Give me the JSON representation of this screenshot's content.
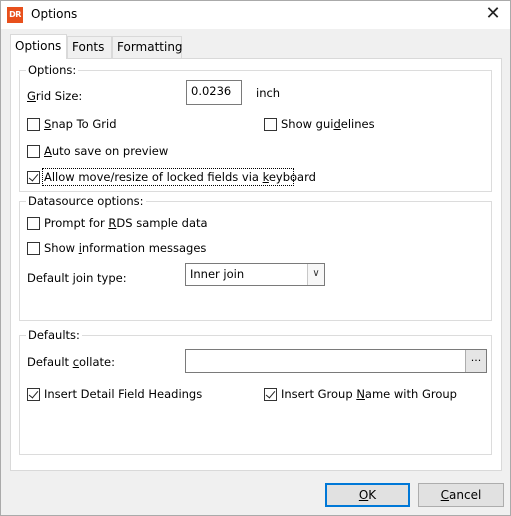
{
  "window": {
    "title": "Options",
    "app_icon_text": "DR",
    "close_glyph": "✕"
  },
  "tabs": [
    {
      "label": "Options",
      "active": true
    },
    {
      "label": "Fonts",
      "active": false
    },
    {
      "label": "Formatting",
      "active": false
    }
  ],
  "options_group": {
    "label": "Options:",
    "grid_size_label_pre": "",
    "grid_size_mnemonic": "G",
    "grid_size_label_post": "rid Size:",
    "grid_size_value": "0.0236",
    "grid_size_unit": "inch",
    "snap_to_grid": {
      "mnemonic": "S",
      "rest": "nap To Grid",
      "checked": false
    },
    "show_guidelines": {
      "pre": "Show gui",
      "mnemonic": "d",
      "post": "elines",
      "checked": false
    },
    "auto_save": {
      "pre": "",
      "mnemonic": "A",
      "post": "uto save on preview",
      "checked": false
    },
    "allow_move": {
      "pre": "Allow move/resize of locked fields via ",
      "mnemonic": "k",
      "post": "eyboard",
      "checked": true
    }
  },
  "datasource_group": {
    "label": "Datasource options:",
    "prompt_rds": {
      "pre": "Prompt for ",
      "mnemonic": "R",
      "post": "DS sample data",
      "checked": false
    },
    "show_info": {
      "pre": "Show ",
      "mnemonic": "i",
      "post": "nformation messages",
      "checked": false
    },
    "join_type_label": "Default join type:",
    "join_type_value": "Inner join"
  },
  "defaults_group": {
    "label": "Defaults:",
    "collate_pre": "Default ",
    "collate_mnemonic": "c",
    "collate_post": "ollate:",
    "collate_value": "",
    "collate_button": "...",
    "insert_detail": {
      "pre": "Insert Detail Field Headings",
      "checked": true
    },
    "insert_group": {
      "pre": "Insert Group ",
      "mnemonic": "N",
      "post": "ame with Group",
      "checked": true
    }
  },
  "buttons": {
    "ok_mnemonic": "O",
    "ok_post": "K",
    "cancel_mnemonic": "C",
    "cancel_post": "ancel"
  }
}
